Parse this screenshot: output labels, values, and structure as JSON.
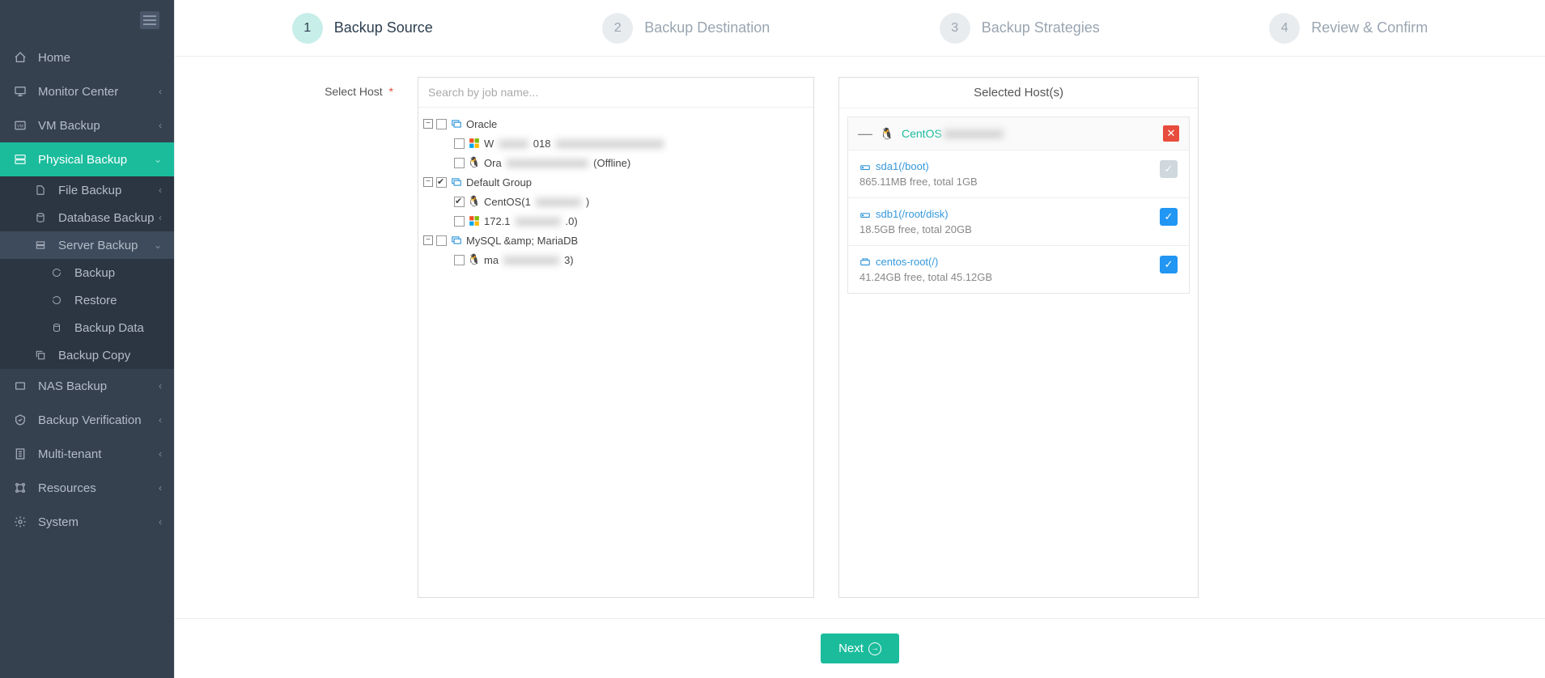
{
  "sidebar": {
    "items": [
      {
        "label": "Home"
      },
      {
        "label": "Monitor Center"
      },
      {
        "label": "VM Backup"
      },
      {
        "label": "Physical Backup"
      },
      {
        "label": "NAS Backup"
      },
      {
        "label": "Backup Verification"
      },
      {
        "label": "Multi-tenant"
      },
      {
        "label": "Resources"
      },
      {
        "label": "System"
      }
    ],
    "physical_sub": [
      {
        "label": "File Backup"
      },
      {
        "label": "Database Backup"
      },
      {
        "label": "Server Backup"
      },
      {
        "label": "Backup Copy"
      }
    ],
    "server_sub": [
      {
        "label": "Backup"
      },
      {
        "label": "Restore"
      },
      {
        "label": "Backup Data"
      }
    ]
  },
  "stepper": {
    "steps": [
      {
        "num": "1",
        "label": "Backup Source"
      },
      {
        "num": "2",
        "label": "Backup Destination"
      },
      {
        "num": "3",
        "label": "Backup Strategies"
      },
      {
        "num": "4",
        "label": "Review & Confirm"
      }
    ]
  },
  "form": {
    "select_host_label": "Select Host",
    "required_mark": "*",
    "search_placeholder": "Search by job name..."
  },
  "tree": {
    "oracle": {
      "label": "Oracle"
    },
    "oracle_child1_prefix": "W",
    "oracle_child1_suffix": "018",
    "oracle_child2_prefix": "Ora",
    "oracle_child2_suffix": "(Offline)",
    "default_group": {
      "label": "Default Group"
    },
    "centos_prefix": "CentOS(1",
    "centos_suffix": ")",
    "ip_prefix": "172.1",
    "ip_suffix": ".0)",
    "mysql": {
      "label": "MySQL &amp; MariaDB"
    },
    "mysql_child_prefix": "ma",
    "mysql_child_suffix": "3)"
  },
  "selected": {
    "title": "Selected Host(s)",
    "host_name": "CentOS",
    "volumes": [
      {
        "name": "sda1(/boot)",
        "meta": "865.11MB free, total 1GB",
        "checked": false,
        "locked": true
      },
      {
        "name": "sdb1(/root/disk)",
        "meta": "18.5GB free, total 20GB",
        "checked": true,
        "locked": false
      },
      {
        "name": "centos-root(/)",
        "meta": "41.24GB free, total 45.12GB",
        "checked": true,
        "locked": false
      }
    ]
  },
  "footer": {
    "next": "Next"
  }
}
